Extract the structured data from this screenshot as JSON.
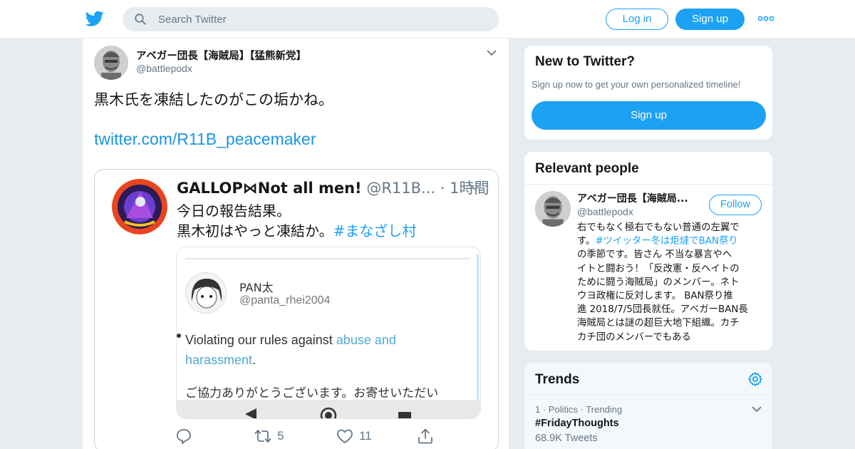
{
  "colors": {
    "brand": "#1da1f2",
    "link": "#1b95e0",
    "text": "#14171a",
    "muted": "#657786",
    "background": "#e6ecf0"
  },
  "header": {
    "logo_icon": "twitter-bird-icon",
    "search": {
      "placeholder": "Search Twitter",
      "icon": "search-icon"
    },
    "login_label": "Log in",
    "signup_label": "Sign up",
    "more_icon": "more-dots-icon"
  },
  "tweet": {
    "author_name": "アベガー団長【海賊局】【猛熊新党】",
    "author_handle": "@battlepodx",
    "text": "黒木氏を凍結したのがこの垢かね。",
    "link": "twitter.com/R11B_peacemaker",
    "embed": {
      "name": "GALLOP⋈Not all men!",
      "meta": " @R11B... · 1時間",
      "line1": "今日の報告結果。",
      "line2_text": "黒木初はやっと凍結か。",
      "line2_hashtag": "#まなざし村",
      "inner": {
        "name": "PAN太",
        "handle": "@panta_rhei2004",
        "violation_text": "Violating our rules against ",
        "violation_link": "abuse and harassment",
        "violation_end": ".",
        "thanks": "ご協力ありがとうございます。お寄せいただい"
      }
    },
    "actions": {
      "reply_count": "",
      "retweet_count": "5",
      "like_count": "11"
    }
  },
  "sidebar": {
    "new_to_twitter": {
      "title": "New to Twitter?",
      "subtitle": "Sign up now to get your own personalized timeline!",
      "button": "Sign up"
    },
    "relevant_people": {
      "title": "Relevant people",
      "name": "アベガー団長【海賊局...",
      "handle": "@battlepodx",
      "follow": "Follow",
      "bio_lines": [
        "右でもなく極右でもない普通の左翼で",
        "す。",
        "#ツイッター冬は炬燵でBAN祭り",
        "の季節です。皆さん 不当な暴言やヘ",
        "イトと闘おう！「反改憲・反ヘイトの",
        "ために闘う海賊局」のメンバー。ネト",
        "ウヨ政権に反対します。 BAN祭り推",
        "進 2018/7/5団長就任。アベガーBAN長",
        "海賊局とは謎の超巨大地下組織。カチ",
        "カチ団のメンバーでもある"
      ]
    },
    "trends": {
      "title": "Trends",
      "items": [
        {
          "rank": "1",
          "category": "Politics",
          "status": "Trending",
          "name": "#FridayThoughts",
          "count": "68.9K Tweets"
        }
      ]
    }
  }
}
